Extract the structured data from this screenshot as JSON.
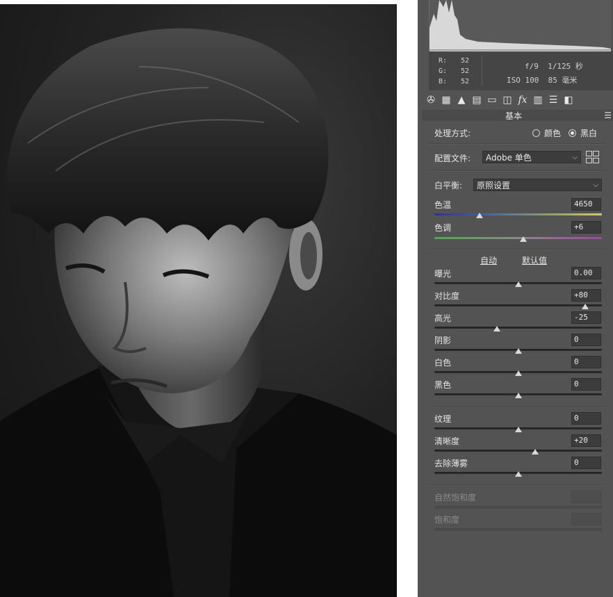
{
  "readout": {
    "r_label": "R:",
    "r_value": "52",
    "g_label": "G:",
    "g_value": "52",
    "b_label": "B:",
    "b_value": "52",
    "exif_line1": "f/9  1/125 秒",
    "exif_line2": "ISO 100  85 毫米"
  },
  "panel": {
    "section_title": "基本",
    "treatment": {
      "label": "处理方式:",
      "option_color": "颜色",
      "option_bw": "黑白",
      "selected": "黑白"
    },
    "profile": {
      "label": "配置文件:",
      "value": "Adobe 单色"
    },
    "white_balance": {
      "label": "白平衡:",
      "value": "原照设置"
    },
    "auto_label": "自动",
    "default_label": "默认值",
    "sliders": {
      "temperature": {
        "label": "色温",
        "value": "4650",
        "level": 0.27
      },
      "tint": {
        "label": "色调",
        "value": "+6",
        "level": 0.53
      },
      "exposure": {
        "label": "曝光",
        "value": "0.00",
        "level": 0.5
      },
      "contrast": {
        "label": "对比度",
        "value": "+80",
        "level": 0.9
      },
      "highlights": {
        "label": "高光",
        "value": "-25",
        "level": 0.375
      },
      "shadows": {
        "label": "阴影",
        "value": "0",
        "level": 0.5
      },
      "whites": {
        "label": "白色",
        "value": "0",
        "level": 0.5
      },
      "blacks": {
        "label": "黑色",
        "value": "0",
        "level": 0.5
      },
      "texture": {
        "label": "纹理",
        "value": "0",
        "level": 0.5
      },
      "clarity": {
        "label": "清晰度",
        "value": "+20",
        "level": 0.6
      },
      "dehaze": {
        "label": "去除薄雾",
        "value": "0",
        "level": 0.5
      },
      "vibrance": {
        "label": "自然饱和度",
        "value": ""
      },
      "saturation": {
        "label": "饱和度",
        "value": ""
      }
    }
  },
  "toolbar_icons": [
    "aperture-icon",
    "grid-icon",
    "mountain-icon",
    "split-tone-icon",
    "detail-icon",
    "lens-icon",
    "fx-icon",
    "film-icon",
    "sliders-icon",
    "presets-icon"
  ]
}
